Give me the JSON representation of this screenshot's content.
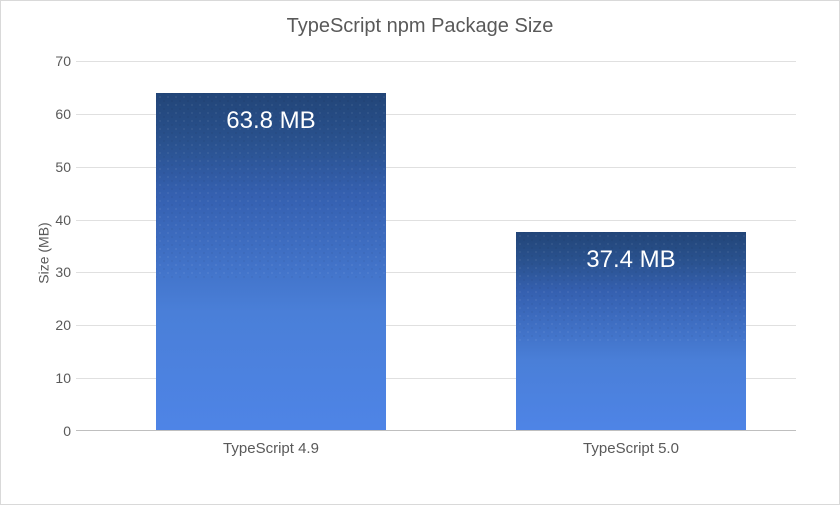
{
  "chart_data": {
    "type": "bar",
    "title": "TypeScript npm Package Size",
    "categories": [
      "TypeScript 4.9",
      "TypeScript 5.0"
    ],
    "values": [
      63.8,
      37.4
    ],
    "value_labels": [
      "63.8 MB",
      "37.4 MB"
    ],
    "ylabel": "Size (MB)",
    "xlabel": "",
    "ylim": [
      0,
      70
    ],
    "yticks": [
      0,
      10,
      20,
      30,
      40,
      50,
      60,
      70
    ]
  }
}
